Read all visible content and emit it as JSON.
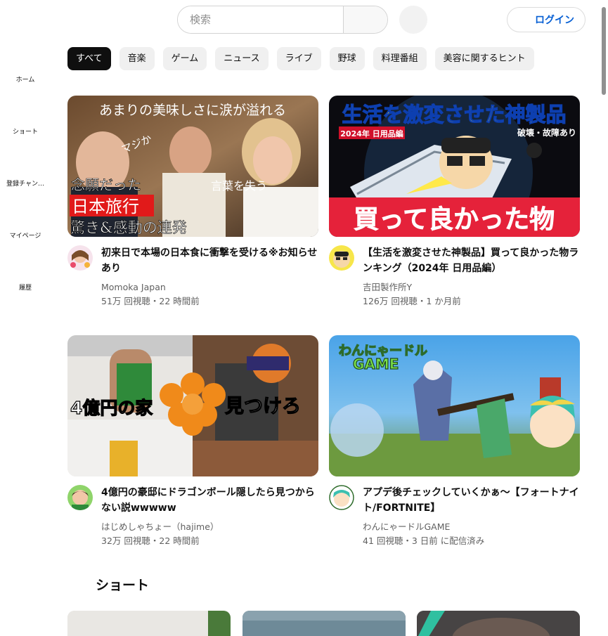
{
  "search": {
    "placeholder": "検索"
  },
  "header": {
    "login_label": "ログイン"
  },
  "sidebar": {
    "items": [
      {
        "label": "ホーム",
        "icon": "home-icon"
      },
      {
        "label": "ショート",
        "icon": "shorts-icon"
      },
      {
        "label": "登録チャン…",
        "icon": "subscriptions-icon"
      },
      {
        "label": "マイページ",
        "icon": "library-icon"
      },
      {
        "label": "履歴",
        "icon": "history-icon"
      }
    ]
  },
  "chips": [
    "すべて",
    "音楽",
    "ゲーム",
    "ニュース",
    "ライブ",
    "野球",
    "料理番組",
    "美容に関するヒント"
  ],
  "videos": [
    {
      "title": "初来日で本場の日本食に衝撃を受ける※お知らせあり",
      "channel": "Momoka Japan",
      "stats": "51万 回視聴・22 時間前",
      "thumb_text": {
        "top": "あまりの美味しさに涙が溢れる",
        "mid1": "マジか",
        "mid2": "言葉を失う",
        "line1": "念願だった",
        "line2": "日本旅行",
        "line3": "驚き&感動の連発"
      }
    },
    {
      "title": "【生活を激変させた神製品】買って良かった物ランキング（2024年 日用品編）",
      "channel": "吉田製作所Y",
      "stats": "126万 回視聴・1 か月前",
      "thumb_text": {
        "top": "生活を激変させた神製品",
        "tag": "2024年 日用品編",
        "note": "破壊・故障あり",
        "bottom": "買って良かった物"
      }
    },
    {
      "title": "4億円の豪邸にドラゴンボール隠したら見つからない説wwwww",
      "channel": "はじめしゃちょー（hajime）",
      "stats": "32万 回視聴・22 時間前",
      "thumb_text": {
        "left": "4億円の家",
        "right": "見つけろ"
      }
    },
    {
      "title": "アプデ後チェックしていくかぁ〜【フォートナイト/FORTNITE】",
      "channel": "わんにゃードルGAME",
      "stats": "41 回視聴・3 日前 に配信済み",
      "thumb_text": {
        "logo1": "わんにゃードル",
        "logo2": "GAME"
      }
    }
  ],
  "shorts": {
    "heading": "ショート"
  },
  "colors": {
    "accent_blue": "#065fd4",
    "chip_active": "#0f0f0f",
    "chip_bg": "#f0f0f0",
    "meta_gray": "#606060"
  }
}
